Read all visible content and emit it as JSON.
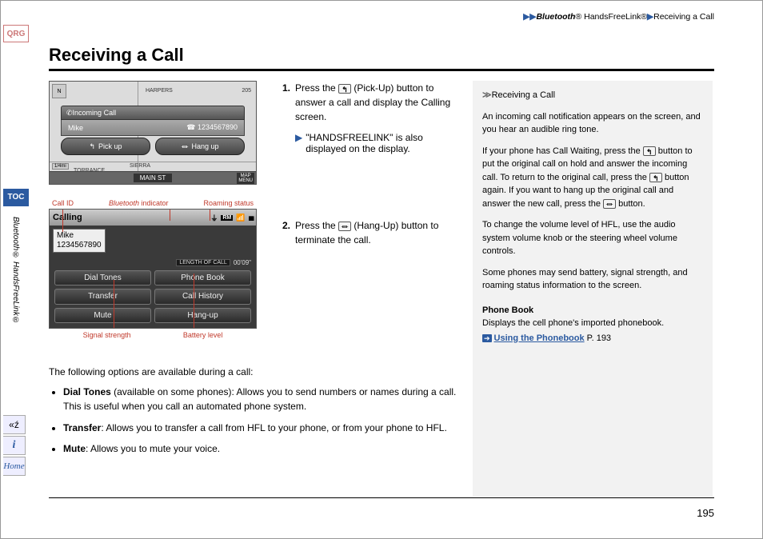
{
  "breadcrumb": {
    "seg1": "Bluetooth",
    "seg1_suffix": "® HandsFreeLink®",
    "seg2": "Receiving a Call"
  },
  "title": "Receiving a Call",
  "left_tabs": {
    "qrg": "QRG",
    "toc": "TOC",
    "side_text": "Bluetooth® HandsFreeLink®",
    "home": "Home",
    "info": "i"
  },
  "fig1": {
    "compass": "N",
    "road_harpers": "HARPERS",
    "road_torrance_w": "TORRANCE",
    "road_sierra": "SIERRA",
    "road_205": "205",
    "scale": "1/4mi",
    "bar_title": "Incoming Call",
    "caller_name": "Mike",
    "caller_num": "1234567890",
    "btn_pickup": "Pick up",
    "btn_hangup": "Hang up",
    "bottom_main": "MAIN ST",
    "bottom_side": "MAP\nMENU"
  },
  "fig2_labels_top": {
    "a": "Call ID",
    "b": "Bluetooth",
    "b_suffix": " indicator",
    "c": "Roaming status"
  },
  "fig2_labels_bot": {
    "a": "Signal strength",
    "b": "Battery level"
  },
  "fig2": {
    "top_title": "Calling",
    "roam": "RM",
    "caller_name": "Mike",
    "caller_num": "1234567890",
    "len_label": "LENGTH OF CALL",
    "len_val": "00'09\"",
    "btns": [
      "Dial Tones",
      "Phone Book",
      "Transfer",
      "Call History",
      "Mute",
      "Hang-up"
    ]
  },
  "steps": {
    "s1_num": "1.",
    "s1": "Press the ",
    "s1b": " (Pick-Up) button to answer a call and display the Calling screen.",
    "s1_sub": "\"HANDSFREELINK\" is also displayed on the display.",
    "s2_num": "2.",
    "s2": "Press the ",
    "s2b": " (Hang-Up) button to terminate the call."
  },
  "below": {
    "intro": "The following options are available during a call:",
    "b1_h": "Dial Tones",
    "b1": " (available on some phones): Allows you to send numbers or names during a call. This is useful when you call an automated phone system.",
    "b2_h": "Transfer",
    "b2": ": Allows you to transfer a call from HFL to your phone, or from your phone to HFL.",
    "b3_h": "Mute",
    "b3": ": Allows you to mute your voice."
  },
  "sidebar": {
    "hdr": "Receiving a Call",
    "p1": "An incoming call notification appears on the screen, and you hear an audible ring tone.",
    "p2a": "If your phone has Call Waiting, press the ",
    "p2b": " button to put the original call on hold and answer the incoming call. To return to the original call, press the ",
    "p2c": " button again. If you want to hang up the original call and answer the new call, press the ",
    "p2d": " button.",
    "p3": "To change the volume level of HFL, use the audio system volume knob or the steering wheel volume controls.",
    "p4": "Some phones may send battery, signal strength, and roaming status information to the screen.",
    "pb_h": "Phone Book",
    "pb_t": "Displays the cell phone's imported phonebook.",
    "link": "Using the Phonebook",
    "link_pg": " P. 193"
  },
  "page": "195"
}
